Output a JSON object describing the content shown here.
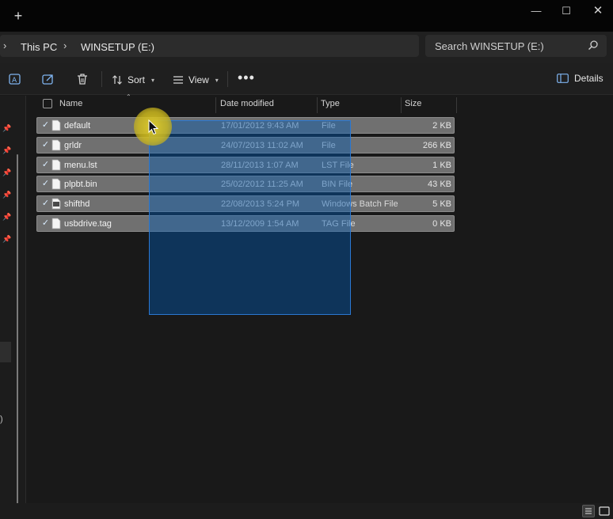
{
  "window": {
    "new_tab_glyph": "+",
    "minimize_glyph": "—",
    "maximize_glyph": "☐",
    "close_glyph": "✕"
  },
  "address": {
    "crumbs": [
      "This PC",
      "WINSETUP (E:)"
    ],
    "search_placeholder": "Search WINSETUP (E:)"
  },
  "toolbar": {
    "sort_label": "Sort",
    "view_label": "View",
    "more_label": "•••",
    "details_label": "Details"
  },
  "columns": {
    "name": "Name",
    "date": "Date modified",
    "type": "Type",
    "size": "Size"
  },
  "files": [
    {
      "name": "default",
      "date": "17/01/2012 9:43 AM",
      "type": "File",
      "size": "2 KB",
      "icon": "blank-file-icon"
    },
    {
      "name": "grldr",
      "date": "24/07/2013 11:02 AM",
      "type": "File",
      "size": "266 KB",
      "icon": "blank-file-icon"
    },
    {
      "name": "menu.lst",
      "date": "28/11/2013 1:07 AM",
      "type": "LST File",
      "size": "1 KB",
      "icon": "blank-file-icon"
    },
    {
      "name": "plpbt.bin",
      "date": "25/02/2012 11:25 AM",
      "type": "BIN File",
      "size": "43 KB",
      "icon": "blank-file-icon"
    },
    {
      "name": "shifthd",
      "date": "22/08/2013 5:24 PM",
      "type": "Windows Batch File",
      "size": "5 KB",
      "icon": "batch-file-icon"
    },
    {
      "name": "usbdrive.tag",
      "date": "13/12/2009 1:54 AM",
      "type": "TAG File",
      "size": "0 KB",
      "icon": "blank-file-icon"
    }
  ],
  "colors": {
    "accent": "#2a78d2",
    "selection": "#707070",
    "background": "#191919"
  }
}
